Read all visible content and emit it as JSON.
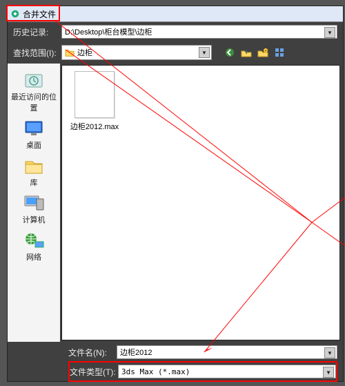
{
  "window": {
    "title": "合并文件"
  },
  "history": {
    "label": "历史记录:",
    "value": "D:\\Desktop\\柜台模型\\边柜"
  },
  "lookin": {
    "label": "查找范围(I):",
    "value": "边柜",
    "folder_icon": "folder-icon"
  },
  "toolbar_icons": [
    "back-icon",
    "up-icon",
    "new-folder-icon",
    "views-icon"
  ],
  "places": [
    {
      "icon": "recent-icon",
      "label": "最近访问的位置"
    },
    {
      "icon": "desktop-icon",
      "label": "桌面"
    },
    {
      "icon": "library-icon",
      "label": "库"
    },
    {
      "icon": "computer-icon",
      "label": "计算机"
    },
    {
      "icon": "network-icon",
      "label": "网络"
    }
  ],
  "files": [
    {
      "name": "边柜2012.max"
    }
  ],
  "filename": {
    "label": "文件名(N):",
    "value": "边柜2012"
  },
  "filetype": {
    "label": "文件类型(T):",
    "value": "3ds Max (*.max)"
  }
}
